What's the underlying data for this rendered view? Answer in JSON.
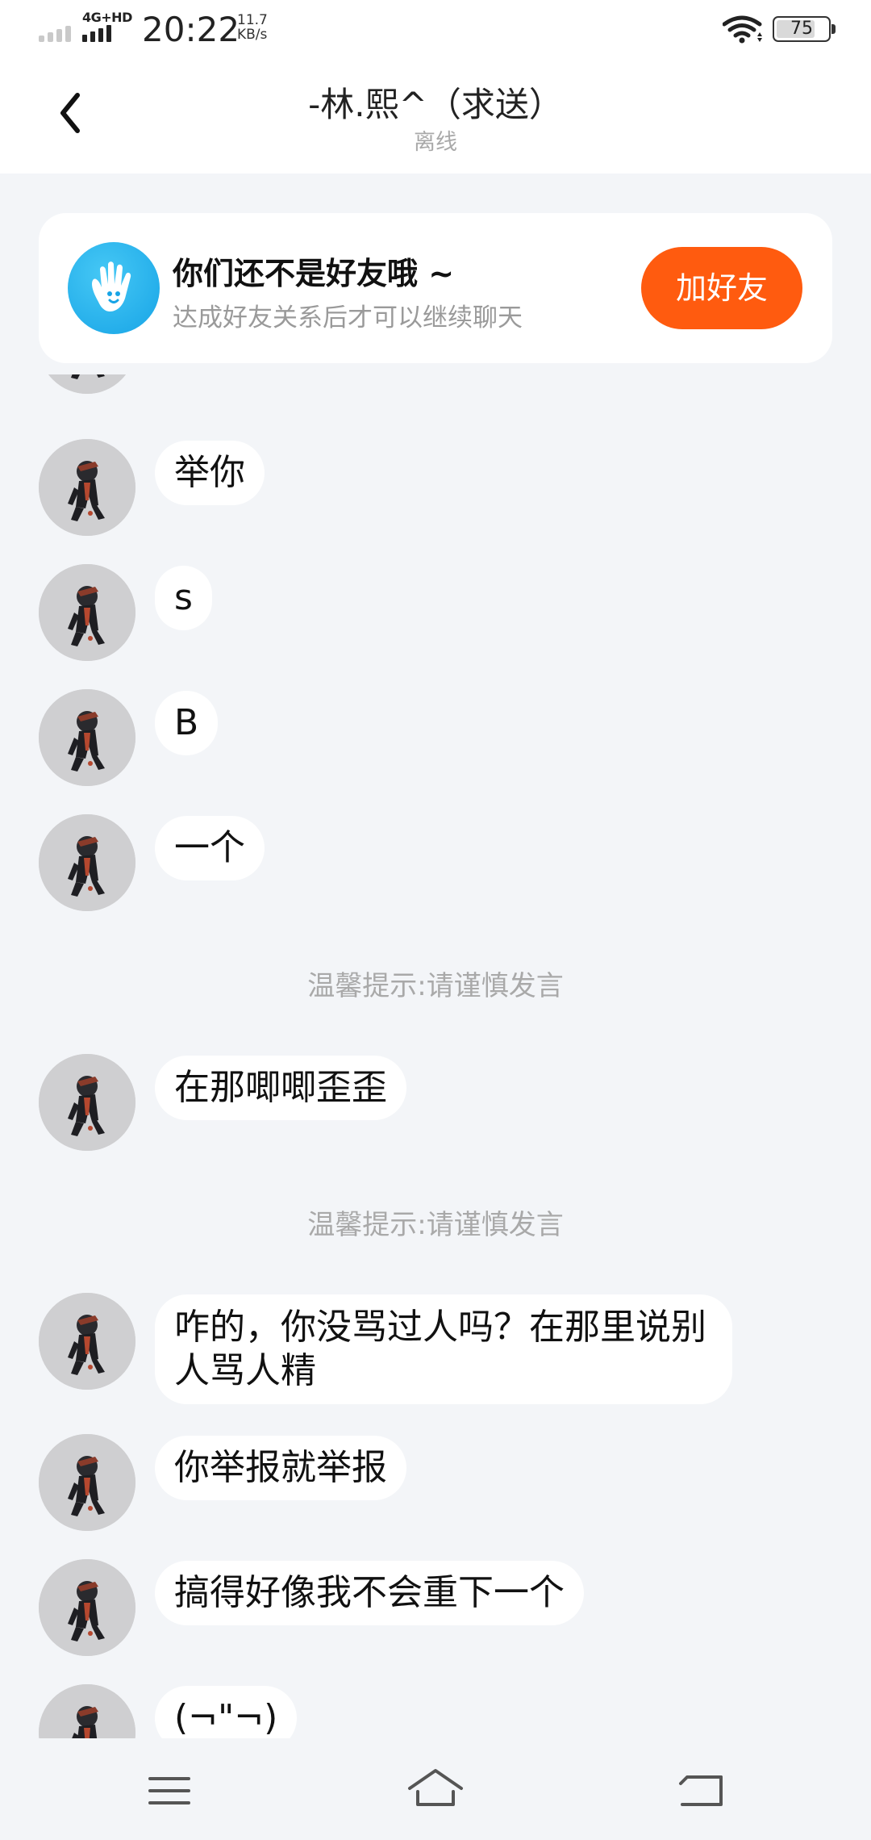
{
  "status_bar": {
    "network": "4G+HD",
    "time": "20:22",
    "speed_value": "11.7",
    "speed_unit": "KB/s",
    "battery": "75",
    "battery_level_percent": 75
  },
  "header": {
    "title": "-林.熙^（求送）",
    "subtitle": "离线",
    "back_icon": "chevron-left-icon"
  },
  "friend_banner": {
    "icon": "waving-hand-icon",
    "title": "你们还不是好友哦 ~",
    "description": "达成好友关系后才可以继续聊天",
    "button_label": "加好友",
    "button_color": "#ff5b0f"
  },
  "messages": [
    {
      "type": "message",
      "text": "举你"
    },
    {
      "type": "message",
      "text": "s"
    },
    {
      "type": "message",
      "text": "B"
    },
    {
      "type": "message",
      "text": "一个"
    },
    {
      "type": "tip",
      "text": "温馨提示:请谨慎发言"
    },
    {
      "type": "message",
      "text": "在那唧唧歪歪"
    },
    {
      "type": "tip",
      "text": "温馨提示:请谨慎发言"
    },
    {
      "type": "message",
      "text": "咋的，你没骂过人吗？在那里说别人骂人精"
    },
    {
      "type": "message",
      "text": "你举报就举报"
    },
    {
      "type": "message",
      "text": "搞得好像我不会重下一个"
    },
    {
      "type": "message",
      "text": "(¬\"¬)"
    }
  ],
  "nav_bar": {
    "menu_icon": "menu-icon",
    "home_icon": "home-icon",
    "back_icon": "back-icon"
  },
  "colors": {
    "background": "#f3f5f8",
    "accent": "#ff5b0f",
    "banner_icon": "#1aa7e8"
  }
}
